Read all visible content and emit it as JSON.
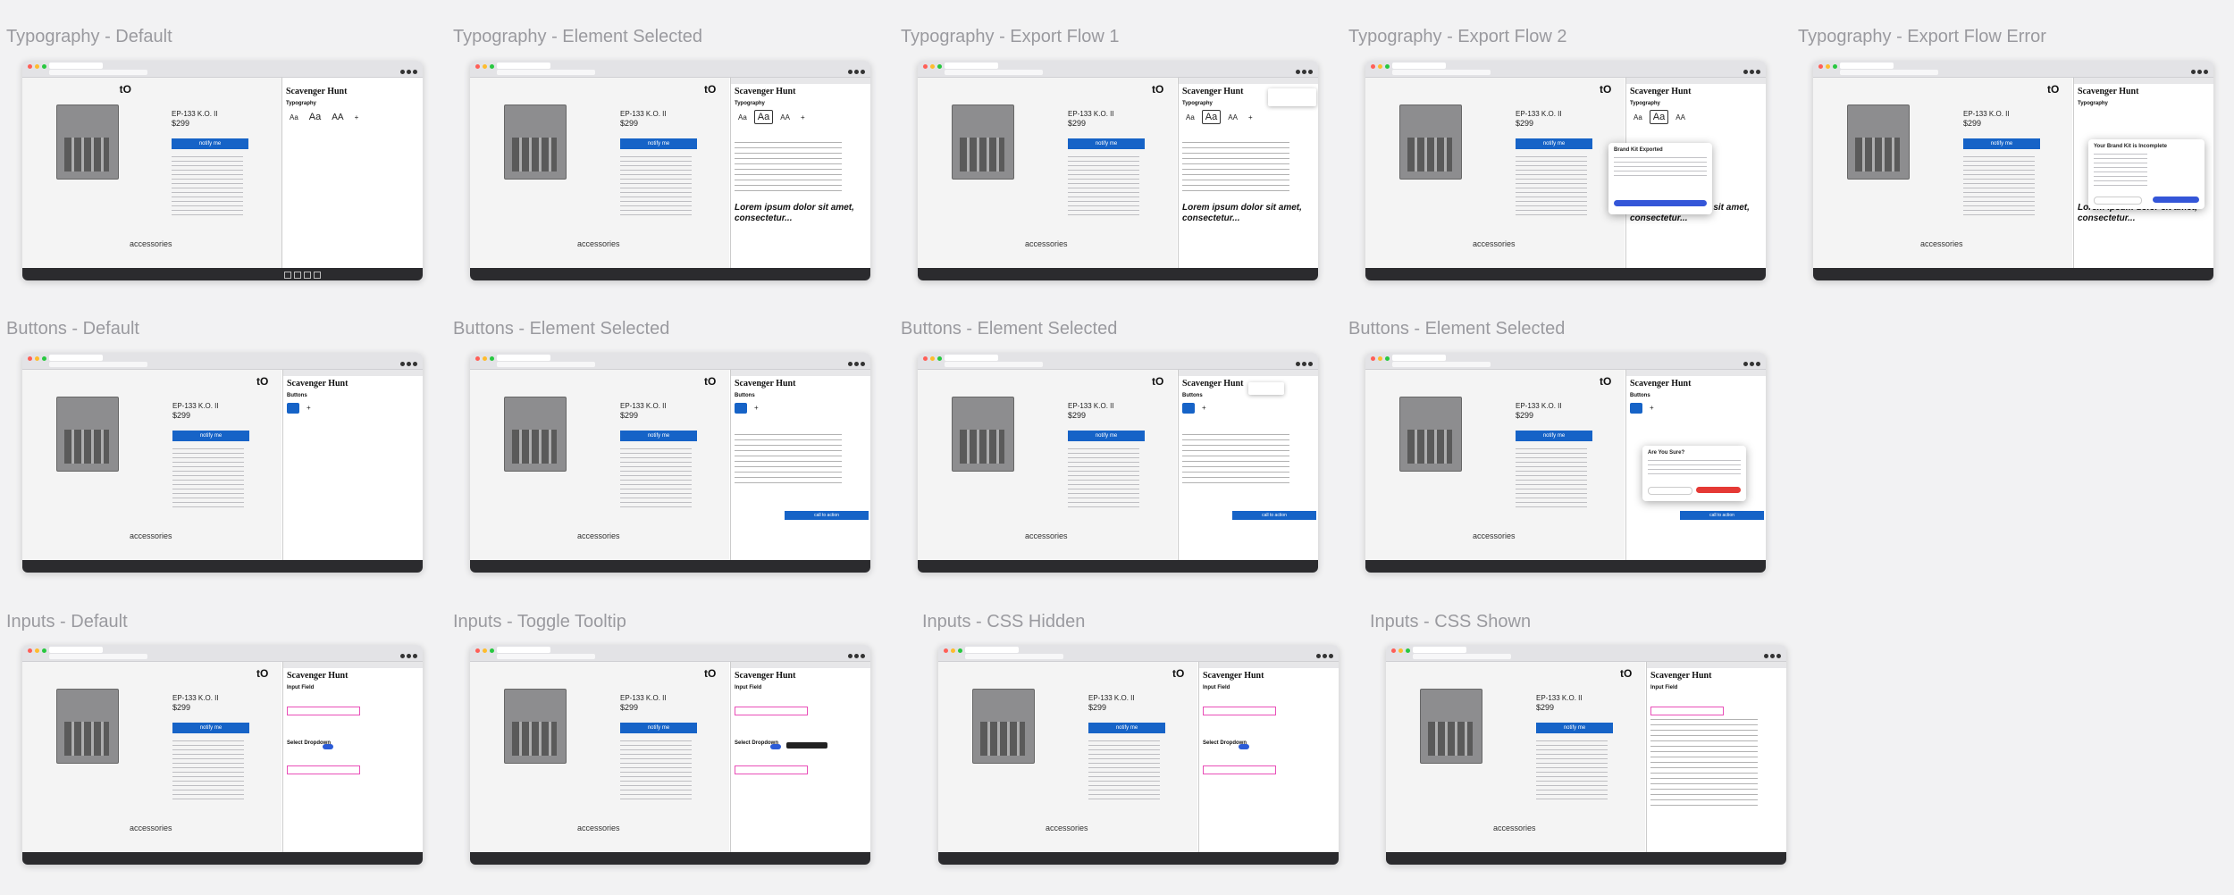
{
  "frames": [
    {
      "title": "Typography - Default"
    },
    {
      "title": "Typography - Element Selected"
    },
    {
      "title": "Typography - Export Flow 1"
    },
    {
      "title": "Typography - Export Flow 2"
    },
    {
      "title": "Typography - Export Flow Error"
    },
    {
      "title": "Buttons - Default"
    },
    {
      "title": "Buttons - Element Selected"
    },
    {
      "title": "Buttons - Element Selected"
    },
    {
      "title": "Buttons - Element Selected"
    },
    {
      "title": "Inputs - Default"
    },
    {
      "title": "Inputs - Toggle Tooltip"
    },
    {
      "title": "Inputs - CSS Hidden"
    },
    {
      "title": "Inputs - CSS Shown"
    }
  ],
  "product": {
    "title": "EP-133 K.O. II",
    "price": "$299",
    "notify": "notify me",
    "accessories": "accessories",
    "logo": "tO"
  },
  "panel": {
    "title": "Scavenger Hunt",
    "typography": "Typography",
    "buttons": "Buttons",
    "input_field": "Input Field",
    "select_dropdown": "Select Dropdown",
    "type_sizes": [
      "Aa",
      "Aa",
      "AA"
    ],
    "add": "+",
    "lorem": "Lorem ipsum dolor sit amet, consectetur...",
    "cta": "call to action"
  },
  "modals": {
    "exported": "Brand Kit Exported",
    "incomplete": "Your Brand Kit is Incomplete",
    "are_you_sure": "Are You Sure?"
  },
  "colors": {
    "accent": "#1663c7",
    "danger": "#e53935",
    "field_border": "#e94fb8",
    "modal_btn": "#3456d8"
  }
}
